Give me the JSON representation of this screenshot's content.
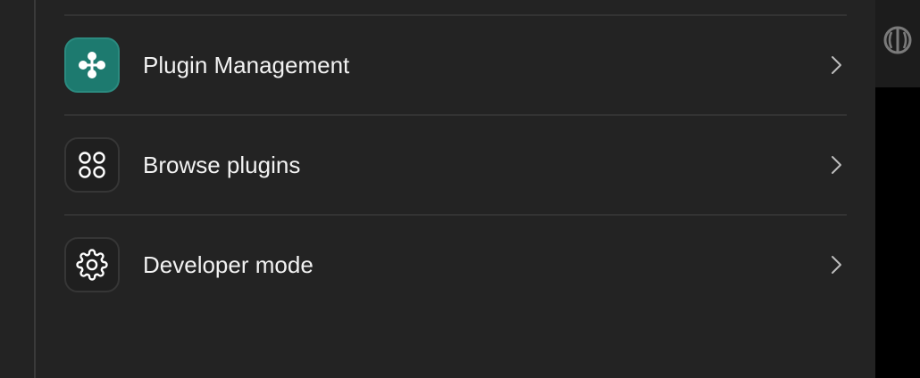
{
  "settings": {
    "items": [
      {
        "label": "Plugin Management",
        "icon": "plugin-management-icon"
      },
      {
        "label": "Browse plugins",
        "icon": "grid-circles-icon"
      },
      {
        "label": "Developer mode",
        "icon": "gear-icon"
      }
    ]
  },
  "colors": {
    "background": "#232323",
    "accent_teal": "#1d7a6f",
    "text": "#f2f2f2",
    "divider": "#333333"
  },
  "side_panel": {
    "icon": "brain-icon"
  }
}
